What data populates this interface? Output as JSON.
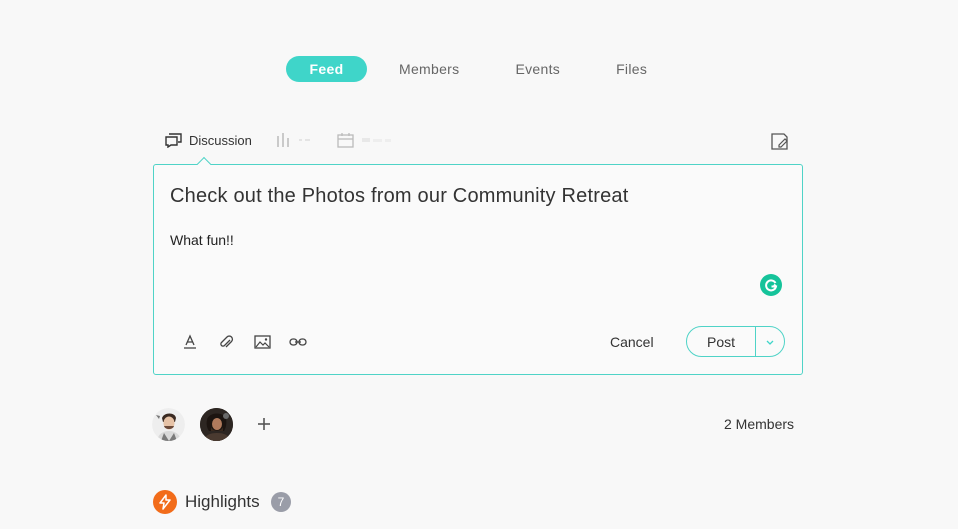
{
  "top_tabs": [
    {
      "label": "Feed",
      "active": true
    },
    {
      "label": "Members",
      "active": false
    },
    {
      "label": "Events",
      "active": false
    },
    {
      "label": "Files",
      "active": false
    }
  ],
  "post_types": {
    "discussion": {
      "label": "Discussion",
      "icon": "discussion-icon"
    },
    "poll": {
      "icon": "poll-icon"
    },
    "event": {
      "icon": "calendar-icon"
    }
  },
  "composer": {
    "title": "Check out the Photos from our Community Retreat",
    "body": "What fun!!",
    "cancel_label": "Cancel",
    "post_label": "Post"
  },
  "members": {
    "count_label": "2 Members"
  },
  "highlights": {
    "label": "Highlights",
    "count": "7"
  },
  "colors": {
    "accent": "#3fd5c9",
    "border": "#4fd3c7",
    "grammarly": "#15c39a",
    "highlight_orange": "#f26c1a",
    "badge_gray": "#9a9da8"
  }
}
